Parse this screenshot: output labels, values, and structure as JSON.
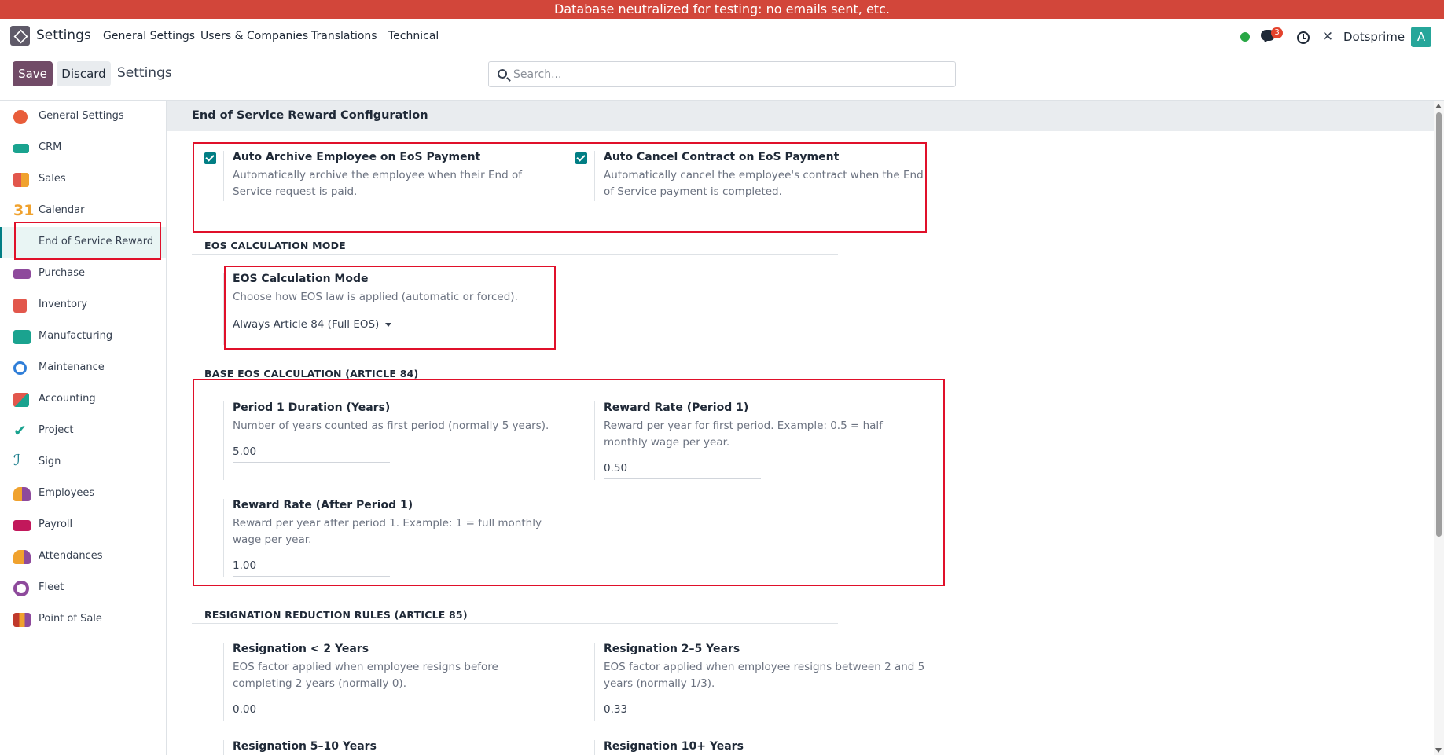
{
  "banner": "Database neutralized for testing: no emails sent, etc.",
  "navbar": {
    "app_name": "Settings",
    "menu": [
      "General Settings",
      "Users & Companies",
      "Translations",
      "Technical"
    ],
    "chat_badge": "3",
    "company": "Dotsprime",
    "avatar_letter": "A"
  },
  "controlbar": {
    "save": "Save",
    "discard": "Discard",
    "title": "Settings",
    "search_placeholder": "Search..."
  },
  "sidebar": {
    "items": [
      {
        "label": "General Settings",
        "icon": "general-settings-icon",
        "color": "#e85d3a"
      },
      {
        "label": "CRM",
        "icon": "crm-icon",
        "color": "#1aa38f"
      },
      {
        "label": "Sales",
        "icon": "sales-icon",
        "color": "#e2574c"
      },
      {
        "label": "Calendar",
        "icon": "calendar-icon",
        "color": "#f0a22e"
      },
      {
        "label": "End of Service Reward",
        "icon": "",
        "color": ""
      },
      {
        "label": "Purchase",
        "icon": "purchase-icon",
        "color": "#8e4a9c"
      },
      {
        "label": "Inventory",
        "icon": "inventory-icon",
        "color": "#e2574c"
      },
      {
        "label": "Manufacturing",
        "icon": "manufacturing-icon",
        "color": "#1aa38f"
      },
      {
        "label": "Maintenance",
        "icon": "maintenance-icon",
        "color": "#2f7ed8"
      },
      {
        "label": "Accounting",
        "icon": "accounting-icon",
        "color": "#e2574c"
      },
      {
        "label": "Project",
        "icon": "project-icon",
        "color": "#1aa38f"
      },
      {
        "label": "Sign",
        "icon": "sign-icon",
        "color": "#1a7d8c"
      },
      {
        "label": "Employees",
        "icon": "employees-icon",
        "color": "#f0a22e"
      },
      {
        "label": "Payroll",
        "icon": "payroll-icon",
        "color": "#c2185b"
      },
      {
        "label": "Attendances",
        "icon": "attendances-icon",
        "color": "#f0a22e"
      },
      {
        "label": "Fleet",
        "icon": "fleet-icon",
        "color": "#8e4a9c"
      },
      {
        "label": "Point of Sale",
        "icon": "point-of-sale-icon",
        "color": "#c0392b"
      }
    ],
    "active_index": 4
  },
  "main": {
    "section_title": "End of Service Reward Configuration",
    "auto": {
      "archive": {
        "title": "Auto Archive Employee on EoS Payment",
        "desc": "Automatically archive the employee when their End of Service request is paid.",
        "checked": true
      },
      "cancel": {
        "title": "Auto Cancel Contract on EoS Payment",
        "desc": "Automatically cancel the employee's contract when the End of Service payment is completed.",
        "checked": true
      }
    },
    "mode": {
      "heading": "EOS CALCULATION MODE",
      "title": "EOS Calculation Mode",
      "desc": "Choose how EOS law is applied (automatic or forced).",
      "value": "Always Article 84 (Full EOS)"
    },
    "base": {
      "heading": "BASE EOS CALCULATION (ARTICLE 84)",
      "period1": {
        "title": "Period 1 Duration (Years)",
        "desc": "Number of years counted as first period (normally 5 years).",
        "value": "5.00"
      },
      "rate1": {
        "title": "Reward Rate (Period 1)",
        "desc": "Reward per year for first period. Example: 0.5 = half monthly wage per year.",
        "value": "0.50"
      },
      "rate_after": {
        "title": "Reward Rate (After Period 1)",
        "desc": "Reward per year after period 1. Example: 1 = full monthly wage per year.",
        "value": "1.00"
      }
    },
    "resign": {
      "heading": "RESIGNATION REDUCTION RULES (ARTICLE 85)",
      "lt2": {
        "title": "Resignation < 2 Years",
        "desc": "EOS factor applied when employee resigns before completing 2 years (normally 0).",
        "value": "0.00"
      },
      "r2_5": {
        "title": "Resignation 2–5 Years",
        "desc": "EOS factor applied when employee resigns between 2 and 5 years (normally 1/3).",
        "value": "0.33"
      },
      "r5_10": {
        "title": "Resignation 5–10 Years"
      },
      "r10": {
        "title": "Resignation 10+ Years"
      }
    }
  }
}
